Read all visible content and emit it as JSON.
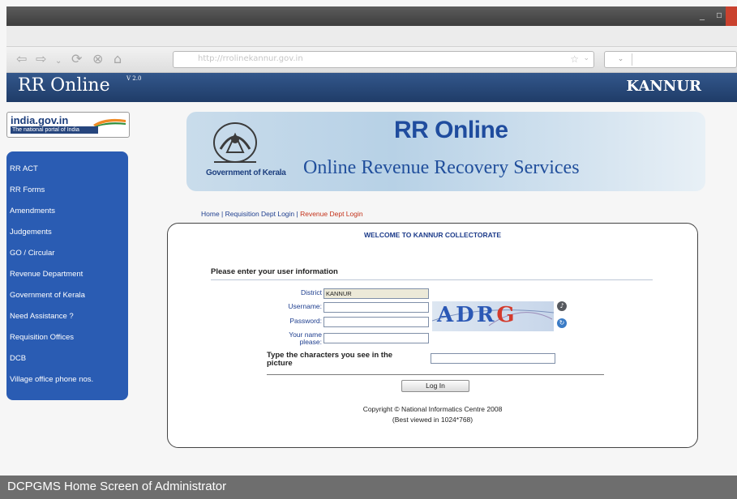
{
  "window": {
    "minimize_symbol": "_",
    "maximize_symbol": "▫"
  },
  "browser": {
    "address_text": "http://rrolinekannur.gov.in",
    "search_dropdown_symbol": "⌄"
  },
  "header": {
    "title": "RR Online",
    "version": "V 2.0",
    "district": "KANNUR"
  },
  "logo": {
    "main": "india.gov.in",
    "sub": "The national portal of India"
  },
  "sidebar": {
    "items": [
      {
        "label": "RR ACT"
      },
      {
        "label": "RR Forms"
      },
      {
        "label": "Amendments"
      },
      {
        "label": "Judgements"
      },
      {
        "label": "GO / Circular"
      },
      {
        "label": "Revenue Department"
      },
      {
        "label": "Government of Kerala"
      },
      {
        "label": "Need Assistance ?"
      },
      {
        "label": "Requisition Offices"
      },
      {
        "label": "DCB"
      },
      {
        "label": "Village office phone nos."
      }
    ],
    "color": "#2a5cb3"
  },
  "banner": {
    "gov_label": "Government of Kerala",
    "title": "RR Online",
    "subtitle": "Online Revenue Recovery Services"
  },
  "breadcrumb": {
    "home": "Home",
    "sep1": " | ",
    "requisition": "Requisition Dept Login",
    "sep2": " | ",
    "revenue": "Revenue Dept Login"
  },
  "login": {
    "welcome": "WELCOME TO KANNUR COLLECTORATE",
    "heading": "Please enter your user information",
    "district_label": "District",
    "district_value": "KANNUR",
    "username_label": "Username:",
    "password_label": "Password:",
    "name_label_line1": "Your name",
    "name_label_line2": "please:",
    "captcha_prompt": "Type the characters you see in the picture",
    "captcha_text": "ADR",
    "captcha_text_g": "G",
    "button": "Log In"
  },
  "footer": {
    "copyright": "Copyright © National Informatics Centre 2008",
    "best_viewed": "(Best viewed in 1024*768)"
  },
  "caption": "DCPGMS Home Screen of Administrator"
}
